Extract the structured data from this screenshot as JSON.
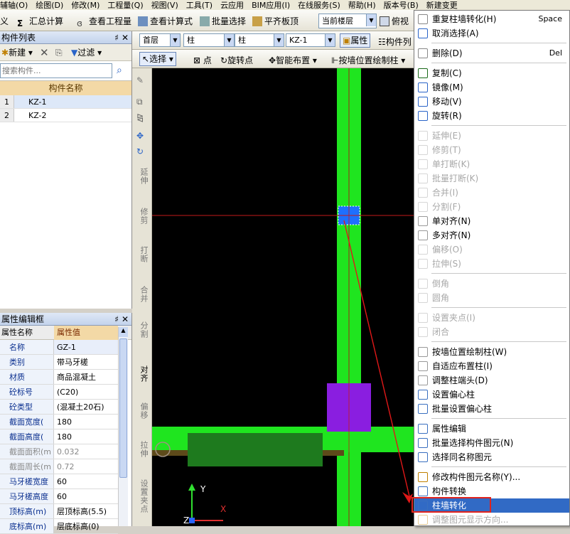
{
  "menubar": [
    "辅轴(O)",
    "绘图(D)",
    "修改(M)",
    "工程量(Q)",
    "视图(V)",
    "工具(T)",
    "云应用",
    "BIM应用(I)",
    "在线服务(S)",
    "帮助(H)",
    "版本号(B)",
    "新建变更"
  ],
  "toolbar1": {
    "item0": "义",
    "sum": "汇总计算",
    "view_qty": "查看工程量",
    "view_formula": "查看计算式",
    "batch_select": "批量选择",
    "flat_slab": "平齐板顶",
    "floor_label": "当前楼层",
    "top_view": "俯视"
  },
  "component_list": {
    "title": "构件列表",
    "new_label": "新建",
    "filter_label": "过滤",
    "search_placeholder": "搜索构件...",
    "col_header": "构件名称",
    "rows": [
      {
        "n": "1",
        "name": "KZ-1"
      },
      {
        "n": "2",
        "name": "KZ-2"
      }
    ]
  },
  "toolbar2": {
    "floor": "首层",
    "cat1": "柱",
    "cat2": "柱",
    "comp": "KZ-1",
    "attr": "属性",
    "comp_list": "构件列"
  },
  "toolbar3": {
    "select": "选择",
    "point": "点",
    "rotate_point": "旋转点",
    "smart_layout": "智能布置",
    "wall_position": "按墙位置绘制柱"
  },
  "property_editor": {
    "title": "属性编辑框",
    "col_name": "属性名称",
    "col_value": "属性值",
    "rows": [
      {
        "name": "名称",
        "value": "GZ-1",
        "grey": false
      },
      {
        "name": "类别",
        "value": "带马牙槎",
        "grey": false
      },
      {
        "name": "材质",
        "value": "商品混凝土",
        "grey": false
      },
      {
        "name": "砼标号",
        "value": "(C20)",
        "grey": false
      },
      {
        "name": "砼类型",
        "value": "(混凝土20石)",
        "grey": false
      },
      {
        "name": "截面宽度(",
        "value": "180",
        "grey": false
      },
      {
        "name": "截面高度(",
        "value": "180",
        "grey": false
      },
      {
        "name": "截面面积(m",
        "value": "0.032",
        "grey": true
      },
      {
        "name": "截面周长(m",
        "value": "0.72",
        "grey": true
      },
      {
        "name": "马牙槎宽度",
        "value": "60",
        "grey": false
      },
      {
        "name": "马牙槎高度",
        "value": "60",
        "grey": false
      },
      {
        "name": "顶标高(m)",
        "value": "层顶标高(5.5)",
        "grey": false
      },
      {
        "name": "底标高(m)",
        "value": "层底标高(0)",
        "grey": false
      }
    ]
  },
  "vertical_tools": [
    "延伸",
    "修剪",
    "打断",
    "合并",
    "分割",
    "对齐",
    "偏移",
    "拉伸",
    "设置夹点"
  ],
  "axis": {
    "y": "Y",
    "x": "X",
    "z": "Z"
  },
  "context_menu": {
    "items": [
      {
        "label": "重复柱墙转化(H)",
        "shortcut": "Space",
        "disabled": false
      },
      {
        "label": "取消选择(A)",
        "disabled": false
      },
      {
        "sep": true
      },
      {
        "label": "删除(D)",
        "shortcut": "Del",
        "disabled": false
      },
      {
        "sep": true
      },
      {
        "label": "复制(C)",
        "disabled": false
      },
      {
        "label": "镜像(M)",
        "disabled": false
      },
      {
        "label": "移动(V)",
        "disabled": false
      },
      {
        "label": "旋转(R)",
        "disabled": false
      },
      {
        "sep": true
      },
      {
        "label": "延伸(E)",
        "disabled": true
      },
      {
        "label": "修剪(T)",
        "disabled": true
      },
      {
        "label": "单打断(K)",
        "disabled": true
      },
      {
        "label": "批量打断(K)",
        "disabled": true
      },
      {
        "label": "合并(I)",
        "disabled": true
      },
      {
        "label": "分割(F)",
        "disabled": true
      },
      {
        "label": "单对齐(N)",
        "disabled": false
      },
      {
        "label": "多对齐(N)",
        "disabled": false
      },
      {
        "label": "偏移(O)",
        "disabled": true
      },
      {
        "label": "拉伸(S)",
        "disabled": true
      },
      {
        "sep": true
      },
      {
        "label": "倒角",
        "disabled": true
      },
      {
        "label": "圆角",
        "disabled": true
      },
      {
        "sep": true
      },
      {
        "label": "设置夹点(I)",
        "disabled": true
      },
      {
        "label": "闭合",
        "disabled": true
      },
      {
        "sep": true
      },
      {
        "label": "按墙位置绘制柱(W)",
        "disabled": false
      },
      {
        "label": "自适应布置柱(I)",
        "disabled": false
      },
      {
        "label": "调整柱端头(D)",
        "disabled": false
      },
      {
        "label": "设置偏心柱",
        "disabled": false
      },
      {
        "label": "批量设置偏心柱",
        "disabled": false
      },
      {
        "sep": true
      },
      {
        "label": "属性编辑",
        "disabled": false
      },
      {
        "label": "批量选择构件图元(N)",
        "disabled": false
      },
      {
        "label": "选择同名称图元",
        "disabled": false
      },
      {
        "sep": true
      },
      {
        "label": "修改构件图元名称(Y)...",
        "disabled": false
      },
      {
        "label": "构件转换",
        "disabled": false
      },
      {
        "label": "柱墙转化",
        "disabled": false,
        "highlight": true
      },
      {
        "label": "调整图元显示方向...",
        "disabled": true
      }
    ]
  },
  "colors": {
    "highlight": "#316ac5",
    "annotation": "#e0231d",
    "wall_green": "#1fe51f",
    "column_purple": "#8a1ee0",
    "selected_blue": "#1e6fff"
  }
}
